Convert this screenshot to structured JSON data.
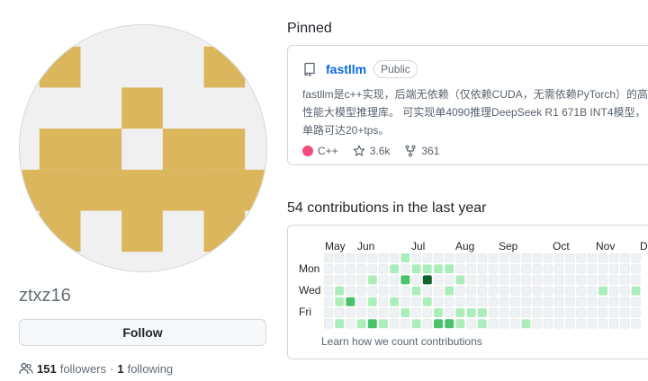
{
  "profile": {
    "username": "ztxz16",
    "follow_label": "Follow",
    "followers_count": "151",
    "followers_label": "followers",
    "separator": "·",
    "following_count": "1",
    "following_label": "following",
    "avatar_colors": {
      "fg": "#dcb65c",
      "bg": "#f0f0f0"
    }
  },
  "pinned": {
    "title": "Pinned",
    "repo": {
      "name": "fastllm",
      "visibility": "Public",
      "description": "fastllm是c++实现，后端无依赖（仅依赖CUDA，无需依赖PyTorch）的高性能大模型推理库。 可实现单4090推理DeepSeek R1 671B INT4模型，单路可达20+tps。",
      "language": "C++",
      "language_color": "#f34b7d",
      "stars": "3.6k",
      "forks": "361"
    }
  },
  "contributions": {
    "title": "54 contributions in the last year",
    "months": [
      "May",
      "Jun",
      "Jul",
      "Aug",
      "Sep",
      "Oct",
      "Nov",
      "D"
    ],
    "days": [
      "Mon",
      "Wed",
      "Fri"
    ],
    "learn_link": "Learn how we count contributions",
    "level_colors": [
      "#eff2f5",
      "#aceebb",
      "#4ac26b",
      "#2da44e",
      "#116329"
    ],
    "cells": [
      [
        1,
        5,
        0
      ],
      [
        1,
        3,
        1
      ],
      [
        1,
        4,
        1
      ],
      [
        1,
        6,
        1
      ],
      [
        2,
        4,
        2
      ],
      [
        3,
        6,
        1
      ],
      [
        4,
        2,
        1
      ],
      [
        4,
        4,
        1
      ],
      [
        4,
        6,
        2
      ],
      [
        5,
        6,
        1
      ],
      [
        6,
        1,
        1
      ],
      [
        6,
        4,
        1
      ],
      [
        7,
        0,
        1
      ],
      [
        7,
        2,
        2
      ],
      [
        7,
        5,
        1
      ],
      [
        8,
        1,
        1
      ],
      [
        8,
        3,
        1
      ],
      [
        8,
        6,
        1
      ],
      [
        8,
        7,
        4
      ],
      [
        9,
        1,
        1
      ],
      [
        9,
        2,
        4
      ],
      [
        9,
        4,
        1
      ],
      [
        10,
        1,
        1
      ],
      [
        10,
        5,
        1
      ],
      [
        10,
        6,
        2
      ],
      [
        11,
        1,
        1
      ],
      [
        11,
        3,
        1
      ],
      [
        11,
        6,
        2
      ],
      [
        12,
        2,
        1
      ],
      [
        12,
        5,
        1
      ],
      [
        12,
        6,
        1
      ],
      [
        13,
        5,
        1
      ],
      [
        14,
        5,
        1
      ],
      [
        14,
        6,
        1
      ],
      [
        18,
        6,
        1
      ],
      [
        25,
        3,
        1
      ],
      [
        28,
        3,
        1
      ]
    ]
  }
}
